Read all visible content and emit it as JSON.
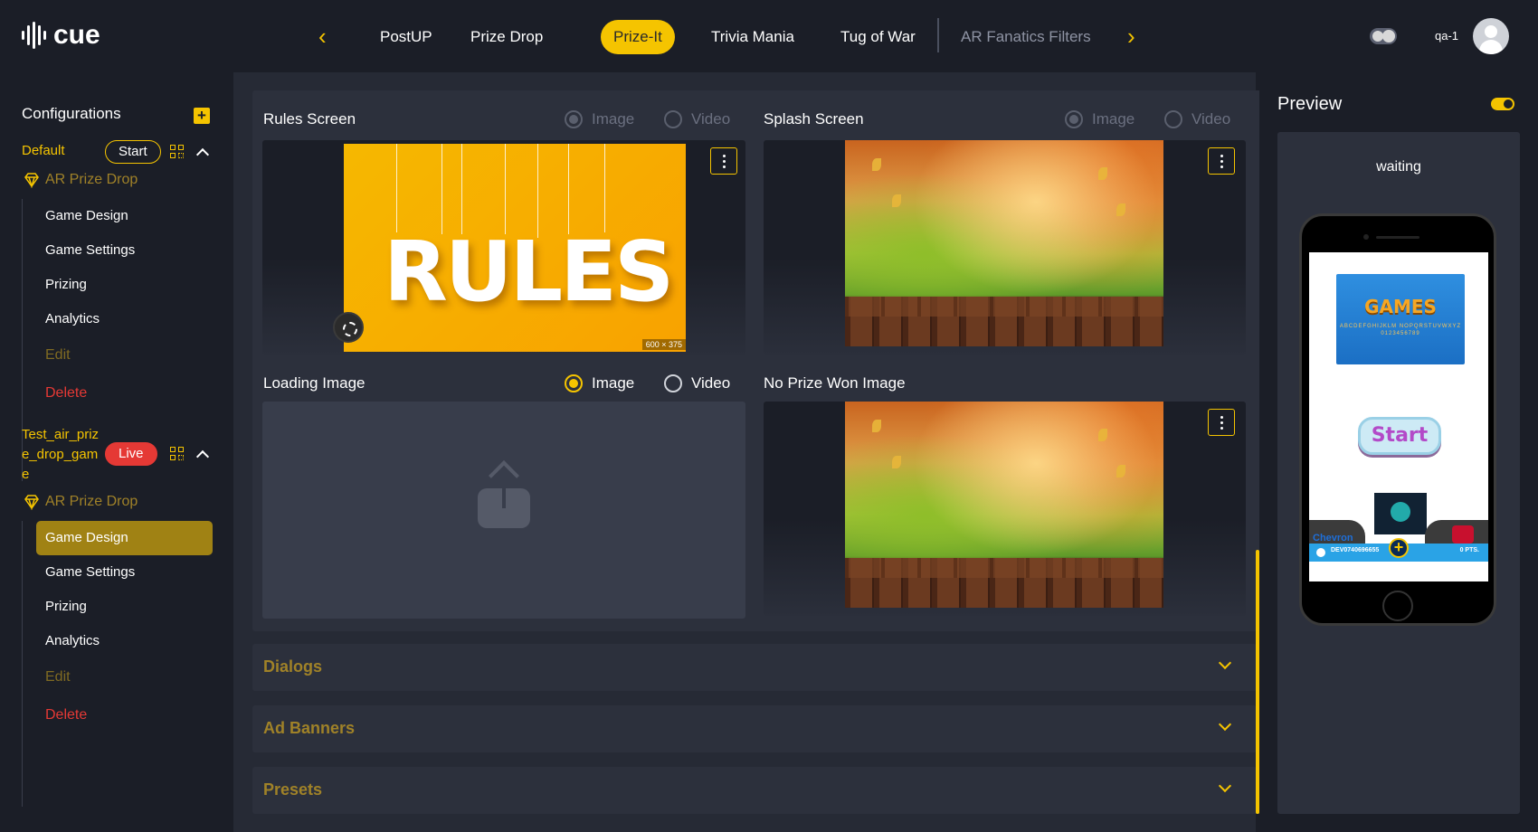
{
  "app": {
    "logo_text": "cue",
    "user": "qa-1"
  },
  "nav": {
    "tabs": [
      {
        "label": "PostUP"
      },
      {
        "label": "Prize Drop"
      },
      {
        "label": "Prize-It"
      },
      {
        "label": "Trivia Mania"
      },
      {
        "label": "Tug of War"
      },
      {
        "label": "AR Fanatics Filters"
      }
    ],
    "active_tab": "Prize-It",
    "prev_icon": "chevron-left-icon",
    "next_icon": "chevron-right-icon"
  },
  "sidebar": {
    "title": "Configurations",
    "add_label": "+",
    "configs": [
      {
        "name": "Default",
        "status": "Start",
        "game": "AR Prize Drop",
        "items": [
          "Game Design",
          "Game Settings",
          "Prizing",
          "Analytics"
        ],
        "edit": "Edit",
        "delete": "Delete"
      },
      {
        "name_lines": [
          "Test_air_priz",
          "e_drop_gam",
          "e"
        ],
        "status": "Live",
        "game": "AR Prize Drop",
        "items": [
          "Game Design",
          "Game Settings",
          "Prizing",
          "Analytics"
        ],
        "active_item": "Game Design",
        "edit": "Edit",
        "delete": "Delete"
      }
    ]
  },
  "media": {
    "rules": {
      "label": "Rules Screen",
      "image_option": "Image",
      "video_option": "Video",
      "image_text": "RULES",
      "image_size": "600 × 375"
    },
    "splash": {
      "label": "Splash Screen",
      "image_option": "Image",
      "video_option": "Video"
    },
    "loading": {
      "label": "Loading Image",
      "image_option": "Image",
      "video_option": "Video"
    },
    "no_prize": {
      "label": "No Prize Won Image"
    }
  },
  "accordions": [
    {
      "label": "Dialogs"
    },
    {
      "label": "Ad Banners"
    },
    {
      "label": "Presets"
    }
  ],
  "preview": {
    "title": "Preview",
    "status": "waiting",
    "games_title": "GAMES",
    "games_alphabet": "ABCDEFGHIJKLM NOPQRSTUVWXYZ 0123456789",
    "start_label": "Start",
    "sponsor": "Chevron",
    "code": "DEV0740696655",
    "points": "0 PTS."
  },
  "colors": {
    "accent": "#f5c400",
    "live": "#e53935",
    "bg": "#1b1e27",
    "panel": "#2c303c"
  }
}
